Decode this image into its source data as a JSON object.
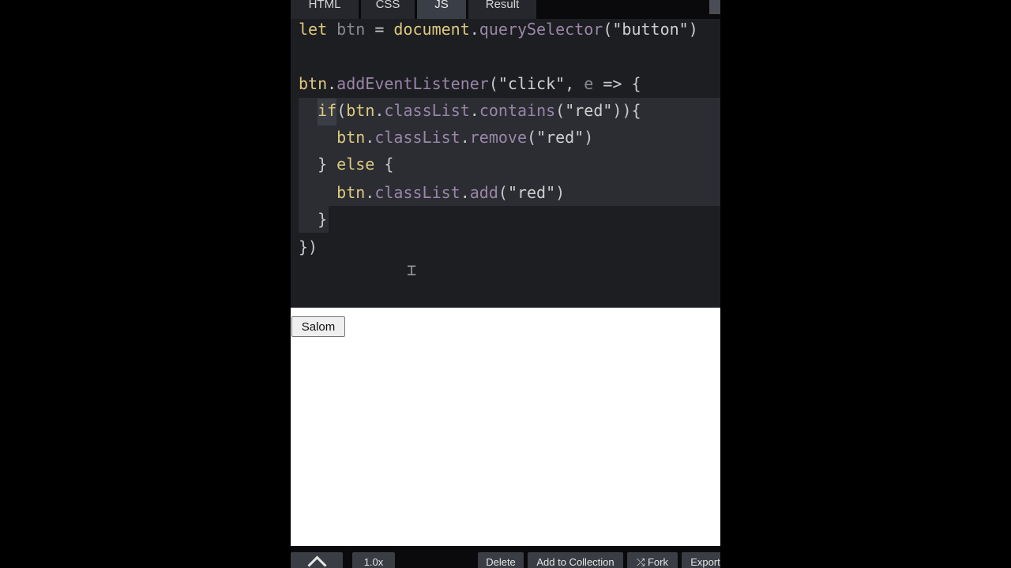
{
  "tabs": {
    "html": "HTML",
    "css": "CSS",
    "js": "JS",
    "result": "Result",
    "active": "JS"
  },
  "editor": {
    "lines": {
      "l1": [
        "let ",
        "btn",
        " = ",
        "document",
        ".",
        "querySelector",
        "(\"button\")"
      ],
      "l3": [
        "btn",
        ".",
        "addEventListener",
        "(",
        "\"click\"",
        ", ",
        "e",
        " => {"
      ],
      "l4": [
        "  ",
        "if",
        "(",
        "btn",
        ".",
        "classList",
        ".",
        "contains",
        "(",
        "\"red\"",
        ")){"
      ],
      "l5": [
        "    ",
        "btn",
        ".",
        "classList",
        ".",
        "remove",
        "(",
        "\"red\"",
        ")"
      ],
      "l6": [
        "  } ",
        "else",
        " {"
      ],
      "l7": [
        "    ",
        "btn",
        ".",
        "classList",
        ".",
        "add",
        "(",
        "\"red\"",
        ")"
      ],
      "l8": [
        "  }"
      ],
      "l9": [
        "})"
      ]
    }
  },
  "result": {
    "button_label": "Salom"
  },
  "bottombar": {
    "zoom": "1.0x",
    "delete": "Delete",
    "add_to_collection": "Add to Collection",
    "fork": "⤮ Fork",
    "export": "Export"
  },
  "icons": {
    "toggle": "chevron-up-icon",
    "text_cursor": "ibeam-cursor-icon"
  },
  "colors": {
    "editor_bg": "#1d1e22",
    "keyword": "#ddca7e",
    "property": "#9a86a8",
    "active_tab": "#3a3e46"
  }
}
